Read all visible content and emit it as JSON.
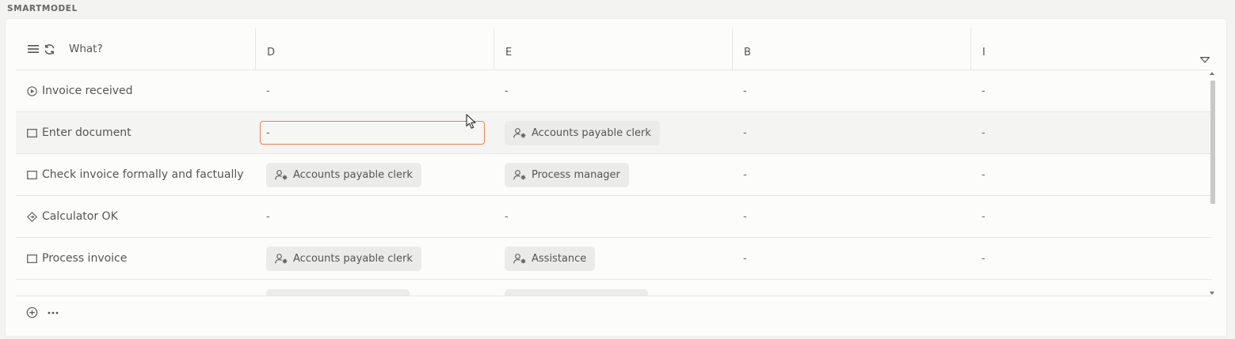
{
  "section": {
    "label": "SMARTMODEL"
  },
  "header": {
    "search_label": "What?",
    "columns": [
      "D",
      "E",
      "B",
      "I"
    ]
  },
  "rows": [
    {
      "label": "Invoice received",
      "icon": "start-event-icon",
      "cells": [
        "-",
        "-",
        "-",
        "-"
      ]
    },
    {
      "label": "Enter document",
      "icon": "task-icon",
      "cells": [
        "-",
        "Accounts payable clerk",
        "-",
        "-"
      ]
    },
    {
      "label": "Check invoice formally and factually",
      "icon": "task-icon",
      "cells": [
        "Accounts payable clerk",
        "Process manager",
        "-",
        "-"
      ]
    },
    {
      "label": "Calculator OK",
      "icon": "gateway-icon",
      "cells": [
        "-",
        "-",
        "-",
        "-"
      ]
    },
    {
      "label": "Process invoice",
      "icon": "task-icon",
      "cells": [
        "Accounts payable clerk",
        "Assistance",
        "-",
        "-"
      ]
    }
  ],
  "colors": {
    "edit_border": "#e8805a",
    "chip_bg": "#ebebea",
    "selected_row_bg": "#f4f4f3"
  }
}
